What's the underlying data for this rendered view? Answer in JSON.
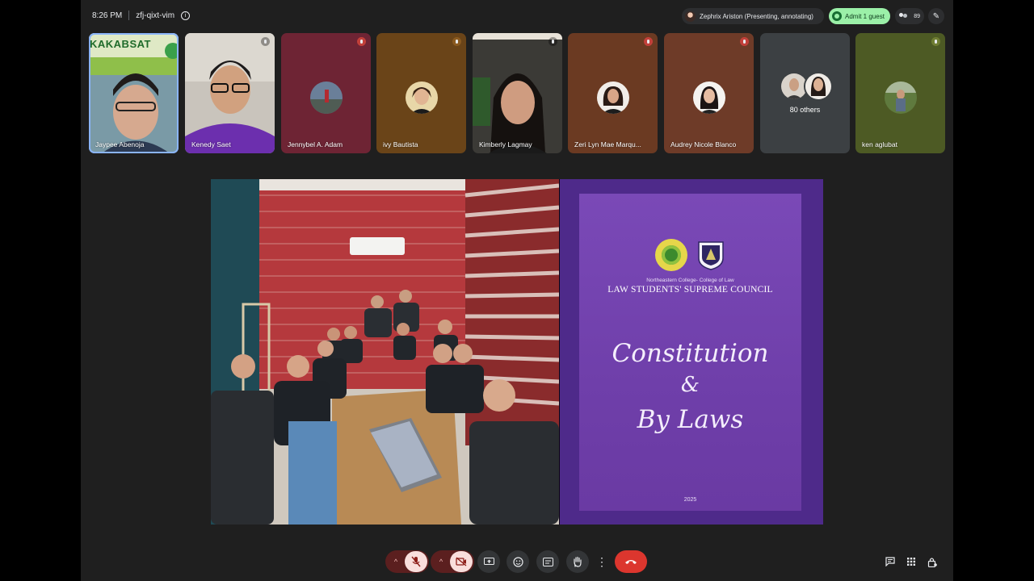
{
  "meeting": {
    "time": "8:26 PM",
    "code": "zfj-qixt-vim"
  },
  "presenter": {
    "label": "Zephrix Ariston (Presenting, annotating)"
  },
  "admit": {
    "label": "Admit 1 guest"
  },
  "participants_count": "89",
  "tiles": [
    {
      "name": "Jaypee Abenoja"
    },
    {
      "name": "Kenedy Saet"
    },
    {
      "name": "Jennybel A. Adam"
    },
    {
      "name": "ivy Bautista"
    },
    {
      "name": "Kimberly Lagmay"
    },
    {
      "name": "Zeri Lyn Mae Marqu..."
    },
    {
      "name": "Audrey Nicole Blanco"
    },
    {
      "others": "80 others"
    },
    {
      "name": "ken aglubat"
    }
  ],
  "tile_banner": "KAKABSAT",
  "slide": {
    "college": "Northeastern College- College of Law",
    "council": "LAW STUDENTS' SUPREME COUNCIL",
    "title_1": "Constitution",
    "title_2": "&",
    "title_3": "By Laws",
    "year": "2025"
  },
  "colors": {
    "accent_blue": "#8ab4f8",
    "admit_green": "#9bf0a8",
    "end_call": "#dc362e",
    "slide_purple": "#6f3faa"
  }
}
